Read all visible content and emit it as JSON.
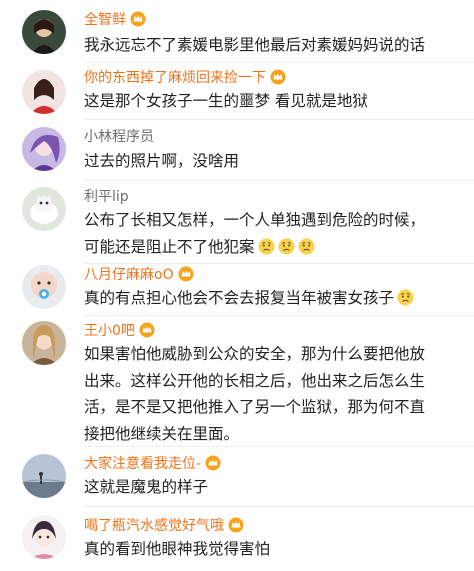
{
  "comments": [
    {
      "name": "全智鲜",
      "name_style": "orange",
      "has_badge": true,
      "text": "我永远忘不了素媛电影里他最后对素媛妈妈说的话"
    },
    {
      "name": "你的东西掉了麻烦回来捡一下",
      "name_style": "orange",
      "has_badge": true,
      "text": "这是那个女孩子一生的噩梦 看见就是地狱"
    },
    {
      "name": "小林程序员",
      "name_style": "gray",
      "has_badge": false,
      "text": "过去的照片啊，没啥用"
    },
    {
      "name": "利平lip",
      "name_style": "gray",
      "has_badge": false,
      "text_lines": [
        "公布了长相又怎样，一个人单独遇到危险的时候，",
        "可能还是阻止不了他犯案"
      ],
      "emoji_count": 3
    },
    {
      "name": "八月仔麻麻oO",
      "name_style": "orange",
      "has_badge": true,
      "text": "真的有点担心他会不会去报复当年被害女孩子",
      "emoji_count": 1
    },
    {
      "name": "王小0吧",
      "name_style": "orange",
      "has_badge": true,
      "text_lines": [
        "如果害怕他威胁到公众的安全，那为什么要把他放",
        "出来。这样公开他的长相之后，他出来之后怎么生",
        "活，是不是又把他推入了另一个监狱，那为何不直",
        "接把他继续关在里面。"
      ]
    },
    {
      "name": "大家注意看我走位-",
      "name_style": "orange",
      "has_badge": true,
      "text": "这就是魔鬼的样子"
    },
    {
      "name": "喝了瓶汽水感觉好气哦",
      "name_style": "orange",
      "has_badge": true,
      "text": "真的看到他眼神我觉得害怕"
    }
  ],
  "colors": {
    "vip_name": "#f0731b",
    "normal_name": "#6d6d6d",
    "text": "#222222",
    "divider": "#ededed"
  },
  "icons": {
    "badge": "vip-crown-badge-icon",
    "emoji": "worried-face-emoji-icon"
  }
}
